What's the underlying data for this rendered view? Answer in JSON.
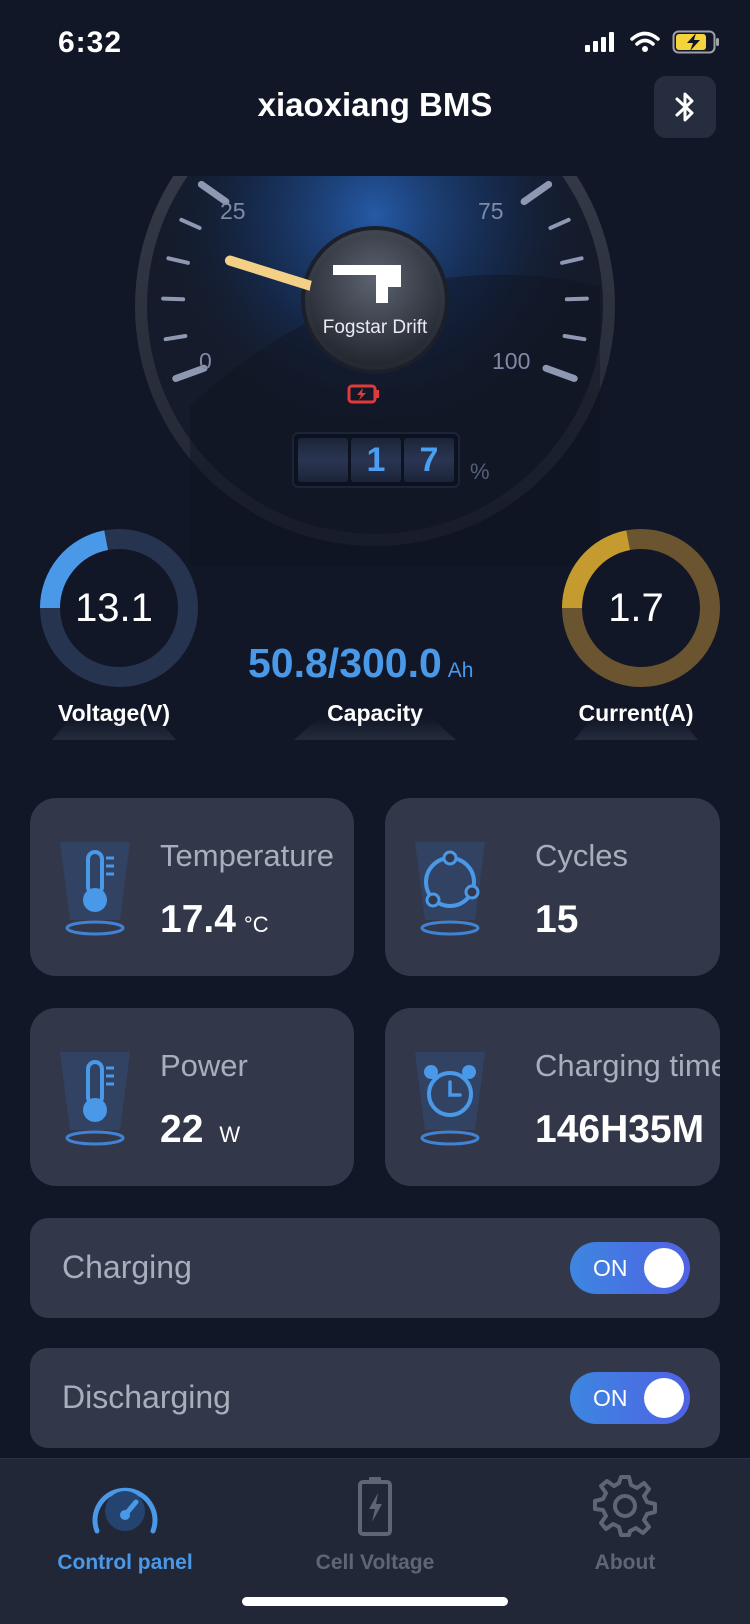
{
  "status_bar": {
    "time": "6:32"
  },
  "header": {
    "title": "xiaoxiang BMS"
  },
  "gauge": {
    "brand": "Fogstar Drift",
    "scale_labels": [
      "0",
      "25",
      "75",
      "100"
    ],
    "digits": [
      "",
      "1",
      "7"
    ],
    "unit": "%",
    "needle_value": 17
  },
  "voltage": {
    "value": "13.1",
    "label": "Voltage(V)",
    "fill_fraction": 0.22,
    "color": "#4a98e8"
  },
  "capacity": {
    "value": "50.8/300.0",
    "unit": "Ah",
    "label": "Capacity"
  },
  "current": {
    "value": "1.7",
    "label": "Current(A)",
    "fill_fraction": 0.22,
    "color": "#c59a2e"
  },
  "cards": {
    "temperature": {
      "title": "Temperature",
      "value": "17.4",
      "unit": "°C"
    },
    "cycles": {
      "title": "Cycles",
      "value": "15"
    },
    "power": {
      "title": "Power",
      "value": "22",
      "unit": "W"
    },
    "charging_time": {
      "title": "Charging time",
      "value": "146H35M"
    }
  },
  "toggles": {
    "charging": {
      "label": "Charging",
      "state": "ON"
    },
    "discharging": {
      "label": "Discharging",
      "state": "ON"
    }
  },
  "tabs": [
    {
      "label": "Control panel",
      "icon": "speedometer-icon",
      "active": true
    },
    {
      "label": "Cell Voltage",
      "icon": "battery-icon",
      "active": false
    },
    {
      "label": "About",
      "icon": "gear-icon",
      "active": false
    }
  ],
  "colors": {
    "accent": "#4a98e8",
    "background": "#111726",
    "card": "#323849",
    "inactive": "#5d6577"
  }
}
